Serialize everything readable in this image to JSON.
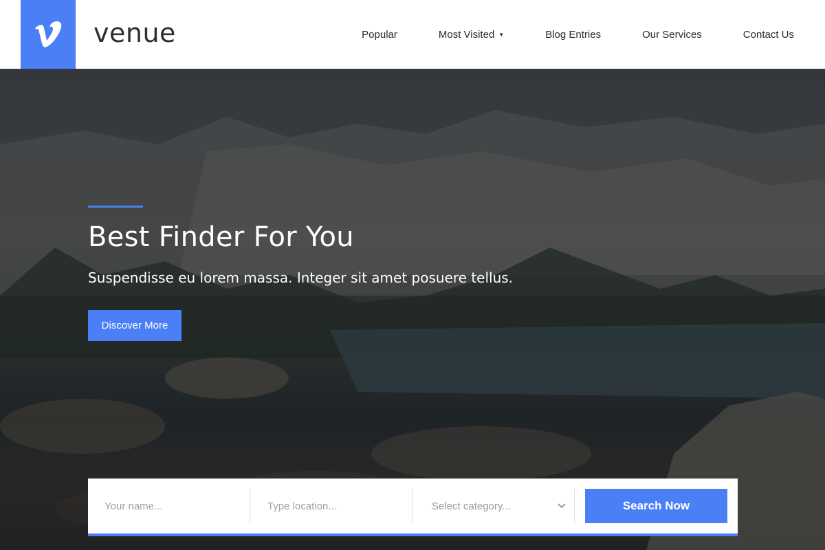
{
  "colors": {
    "accent": "#4a7ff5"
  },
  "brand": {
    "logo_icon": "vimeo-v-icon",
    "name": "venue"
  },
  "nav": {
    "items": [
      {
        "label": "Popular"
      },
      {
        "label": "Most Visited",
        "has_dropdown": true,
        "dropdown_icon": "caret-down-icon"
      },
      {
        "label": "Blog Entries"
      },
      {
        "label": "Our Services"
      },
      {
        "label": "Contact Us"
      }
    ]
  },
  "hero": {
    "title": "Best Finder For You",
    "subtitle": "Suspendisse eu lorem massa. Integer sit amet posuere tellus.",
    "button_label": "Discover More"
  },
  "search": {
    "name_placeholder": "Your name...",
    "location_placeholder": "Type location...",
    "category_selected": "Select category...",
    "category_icon": "chevron-down-icon",
    "button_label": "Search Now"
  }
}
